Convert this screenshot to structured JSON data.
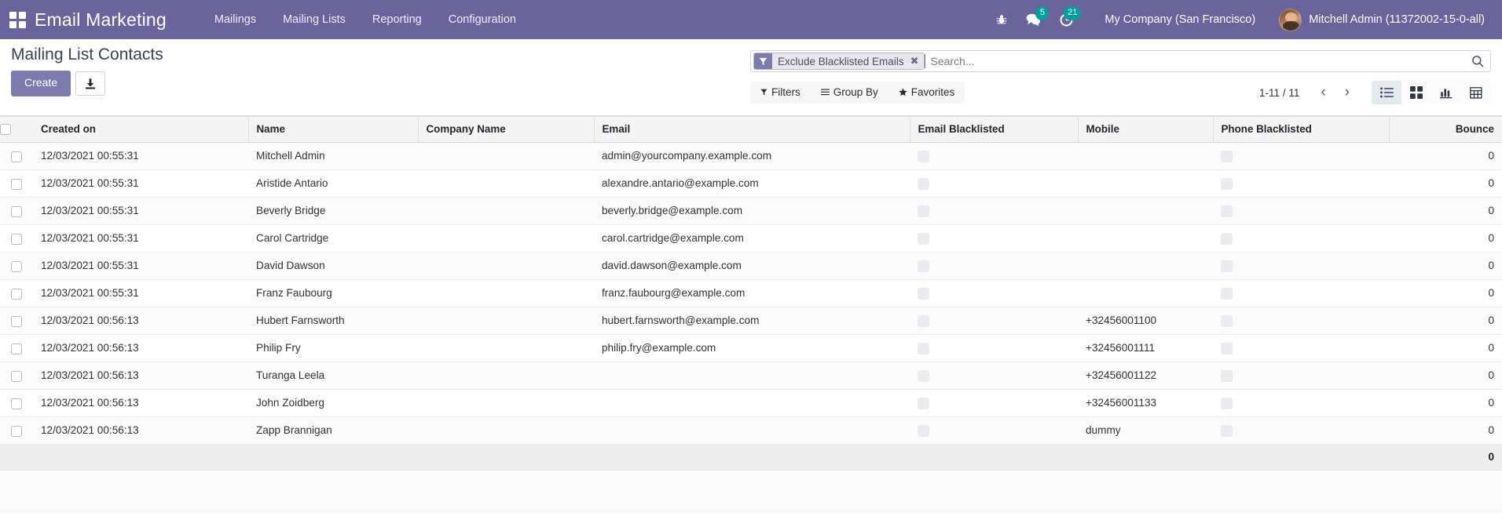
{
  "navbar": {
    "apps_icon": "apps-grid-icon",
    "brand": "Email Marketing",
    "menu": [
      {
        "label": "Mailings"
      },
      {
        "label": "Mailing Lists"
      },
      {
        "label": "Reporting"
      },
      {
        "label": "Configuration"
      }
    ],
    "debug_icon": "bug-icon",
    "messages_icon": "messages-icon",
    "messages_count": "5",
    "activities_icon": "activity-clock-icon",
    "activities_count": "21",
    "company": "My Company (San Francisco)",
    "user": "Mitchell Admin (11372002-15-0-all)",
    "accent_color": "#6b639c",
    "badge_color": "#00A09D"
  },
  "control_panel": {
    "title": "Mailing List Contacts",
    "create_label": "Create",
    "export_icon": "import-download-icon",
    "search": {
      "facet_icon": "filter-funnel-icon",
      "facet_label": "Exclude Blacklisted Emails",
      "facet_remove_icon": "close-x-icon",
      "placeholder": "Search...",
      "value": "",
      "search_icon": "search-icon"
    },
    "dropdowns": [
      {
        "label": "Filters",
        "icon": "filter-funnel-icon"
      },
      {
        "label": "Group By",
        "icon": "hamburger-lines-icon"
      },
      {
        "label": "Favorites",
        "icon": "star-icon"
      }
    ],
    "pager": {
      "range": "1-11 / 11",
      "prev_icon": "chevron-left-icon",
      "next_icon": "chevron-right-icon"
    },
    "views": [
      {
        "name": "list",
        "icon": "list-view-icon",
        "active": true
      },
      {
        "name": "kanban",
        "icon": "kanban-view-icon",
        "active": false
      },
      {
        "name": "graph",
        "icon": "graph-view-icon",
        "active": false
      },
      {
        "name": "pivot",
        "icon": "pivot-view-icon",
        "active": false
      }
    ]
  },
  "table": {
    "columns": [
      {
        "key": "created_on",
        "label": "Created on"
      },
      {
        "key": "name",
        "label": "Name"
      },
      {
        "key": "company_name",
        "label": "Company Name"
      },
      {
        "key": "email",
        "label": "Email"
      },
      {
        "key": "email_blacklisted",
        "label": "Email Blacklisted"
      },
      {
        "key": "mobile",
        "label": "Mobile"
      },
      {
        "key": "phone_blacklisted",
        "label": "Phone Blacklisted"
      },
      {
        "key": "bounce",
        "label": "Bounce"
      }
    ],
    "rows": [
      {
        "created_on": "12/03/2021 00:55:31",
        "name": "Mitchell Admin",
        "company_name": "",
        "email": "admin@yourcompany.example.com",
        "email_blacklisted": false,
        "mobile": "",
        "phone_blacklisted": false,
        "bounce": "0"
      },
      {
        "created_on": "12/03/2021 00:55:31",
        "name": "Aristide Antario",
        "company_name": "",
        "email": "alexandre.antario@example.com",
        "email_blacklisted": false,
        "mobile": "",
        "phone_blacklisted": false,
        "bounce": "0"
      },
      {
        "created_on": "12/03/2021 00:55:31",
        "name": "Beverly Bridge",
        "company_name": "",
        "email": "beverly.bridge@example.com",
        "email_blacklisted": false,
        "mobile": "",
        "phone_blacklisted": false,
        "bounce": "0"
      },
      {
        "created_on": "12/03/2021 00:55:31",
        "name": "Carol Cartridge",
        "company_name": "",
        "email": "carol.cartridge@example.com",
        "email_blacklisted": false,
        "mobile": "",
        "phone_blacklisted": false,
        "bounce": "0"
      },
      {
        "created_on": "12/03/2021 00:55:31",
        "name": "David Dawson",
        "company_name": "",
        "email": "david.dawson@example.com",
        "email_blacklisted": false,
        "mobile": "",
        "phone_blacklisted": false,
        "bounce": "0"
      },
      {
        "created_on": "12/03/2021 00:55:31",
        "name": "Franz Faubourg",
        "company_name": "",
        "email": "franz.faubourg@example.com",
        "email_blacklisted": false,
        "mobile": "",
        "phone_blacklisted": false,
        "bounce": "0"
      },
      {
        "created_on": "12/03/2021 00:56:13",
        "name": "Hubert Farnsworth",
        "company_name": "",
        "email": "hubert.farnsworth@example.com",
        "email_blacklisted": false,
        "mobile": "+32456001100",
        "phone_blacklisted": false,
        "bounce": "0"
      },
      {
        "created_on": "12/03/2021 00:56:13",
        "name": "Philip Fry",
        "company_name": "",
        "email": "philip.fry@example.com",
        "email_blacklisted": false,
        "mobile": "+32456001111",
        "phone_blacklisted": false,
        "bounce": "0"
      },
      {
        "created_on": "12/03/2021 00:56:13",
        "name": "Turanga Leela",
        "company_name": "",
        "email": "",
        "email_blacklisted": false,
        "mobile": "+32456001122",
        "phone_blacklisted": false,
        "bounce": "0"
      },
      {
        "created_on": "12/03/2021 00:56:13",
        "name": "John Zoidberg",
        "company_name": "",
        "email": "",
        "email_blacklisted": false,
        "mobile": "+32456001133",
        "phone_blacklisted": false,
        "bounce": "0"
      },
      {
        "created_on": "12/03/2021 00:56:13",
        "name": "Zapp Brannigan",
        "company_name": "",
        "email": "",
        "email_blacklisted": false,
        "mobile": "dummy",
        "phone_blacklisted": false,
        "bounce": "0"
      }
    ],
    "footer": {
      "bounce_total": "0"
    }
  }
}
